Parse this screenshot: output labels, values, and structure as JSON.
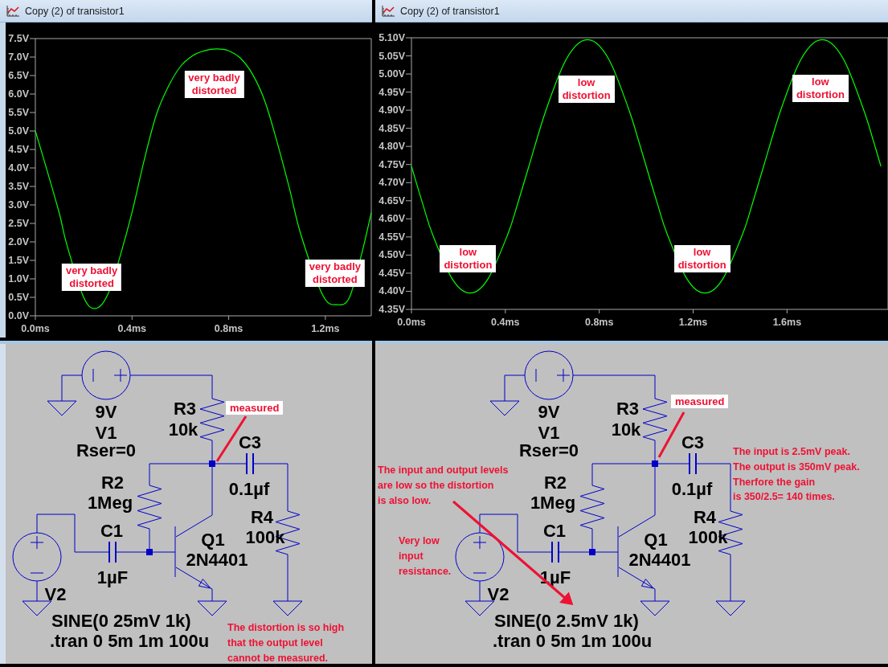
{
  "windows": [
    {
      "title": "Copy (2) of transistor1",
      "chart_data": {
        "type": "line",
        "xlim": [
          0,
          1.39
        ],
        "ylim": [
          0,
          7.5
        ],
        "x": [
          0,
          0.05,
          0.1,
          0.13,
          0.2,
          0.25,
          0.3,
          0.35,
          0.4,
          0.45,
          0.5,
          0.55,
          0.6,
          0.65,
          0.7,
          0.75,
          0.8,
          0.85,
          0.9,
          0.95,
          1.0,
          1.05,
          1.1,
          1.19,
          1.25,
          1.3,
          1.35,
          1.39
        ],
        "series": [
          {
            "color": "#00ff00",
            "values": [
              5.0,
              3.9,
              2.75,
              1.93,
              0.5,
              0.2,
              0.58,
              1.6,
              2.8,
              4.2,
              5.43,
              6.2,
              6.74,
              7.03,
              7.17,
              7.22,
              7.17,
              6.96,
              6.52,
              5.8,
              4.71,
              3.48,
              2.17,
              0.55,
              0.3,
              0.5,
              1.67,
              2.79
            ]
          }
        ],
        "xticks": [
          {
            "value": 0,
            "label": "0.0ms"
          },
          {
            "value": 0.4,
            "label": "0.4ms"
          },
          {
            "value": 0.8,
            "label": "0.8ms"
          },
          {
            "value": 1.2,
            "label": "1.2ms"
          }
        ],
        "yticks": [
          {
            "value": 0,
            "label": "0.0V"
          },
          {
            "value": 0.5,
            "label": "0.5V"
          },
          {
            "value": 1,
            "label": "1.0V"
          },
          {
            "value": 1.5,
            "label": "1.5V"
          },
          {
            "value": 2,
            "label": "2.0V"
          },
          {
            "value": 2.5,
            "label": "2.5V"
          },
          {
            "value": 3,
            "label": "3.0V"
          },
          {
            "value": 3.5,
            "label": "3.5V"
          },
          {
            "value": 4,
            "label": "4.0V"
          },
          {
            "value": 4.5,
            "label": "4.5V"
          },
          {
            "value": 5,
            "label": "5.0V"
          },
          {
            "value": 5.5,
            "label": "5.5V"
          },
          {
            "value": 6,
            "label": "6.0V"
          },
          {
            "value": 6.5,
            "label": "6.5V"
          },
          {
            "value": 7,
            "label": "7.0V"
          },
          {
            "value": 7.5,
            "label": "7.5V"
          }
        ],
        "annotations": [
          {
            "text": "very badly\ndistorted"
          },
          {
            "text": "very badly\ndistorted"
          },
          {
            "text": "very badly\ndistorted"
          }
        ]
      }
    },
    {
      "title": "Copy (2) of transistor1",
      "chart_data": {
        "type": "line",
        "xlim": [
          0,
          2.03
        ],
        "ylim": [
          4.35,
          5.1
        ],
        "x": [
          0,
          0.05,
          0.09,
          0.175,
          0.25,
          0.325,
          0.41,
          0.45,
          0.5,
          0.57,
          0.645,
          0.7,
          0.75,
          0.8,
          0.855,
          0.93,
          0.97,
          1.0,
          1.05,
          1.09,
          1.175,
          1.25,
          1.325,
          1.41,
          1.45,
          1.5,
          1.57,
          1.645,
          1.7,
          1.75,
          1.8,
          1.855,
          1.93,
          1.97,
          2.0
        ],
        "series": [
          {
            "color": "#00ff00",
            "values": [
              4.745,
              4.637,
              4.557,
              4.433,
              4.395,
              4.433,
              4.557,
              4.637,
              4.745,
              4.894,
              5.022,
              5.078,
              5.095,
              5.078,
              5.022,
              4.894,
              4.81,
              4.745,
              4.637,
              4.557,
              4.433,
              4.395,
              4.433,
              4.557,
              4.637,
              4.745,
              4.894,
              5.022,
              5.078,
              5.095,
              5.078,
              5.022,
              4.894,
              4.81,
              4.745
            ]
          }
        ],
        "xticks": [
          {
            "value": 0,
            "label": "0.0ms"
          },
          {
            "value": 0.4,
            "label": "0.4ms"
          },
          {
            "value": 0.8,
            "label": "0.8ms"
          },
          {
            "value": 1.2,
            "label": "1.2ms"
          },
          {
            "value": 1.6,
            "label": "1.6ms"
          }
        ],
        "yticks": [
          {
            "value": 4.35,
            "label": "4.35V"
          },
          {
            "value": 4.4,
            "label": "4.40V"
          },
          {
            "value": 4.45,
            "label": "4.45V"
          },
          {
            "value": 4.5,
            "label": "4.50V"
          },
          {
            "value": 4.55,
            "label": "4.55V"
          },
          {
            "value": 4.6,
            "label": "4.60V"
          },
          {
            "value": 4.65,
            "label": "4.65V"
          },
          {
            "value": 4.7,
            "label": "4.70V"
          },
          {
            "value": 4.75,
            "label": "4.75V"
          },
          {
            "value": 4.8,
            "label": "4.80V"
          },
          {
            "value": 4.85,
            "label": "4.85V"
          },
          {
            "value": 4.9,
            "label": "4.90V"
          },
          {
            "value": 4.95,
            "label": "4.95V"
          },
          {
            "value": 5.0,
            "label": "5.00V"
          },
          {
            "value": 5.05,
            "label": "5.05V"
          },
          {
            "value": 5.1,
            "label": "5.10V"
          }
        ],
        "annotations": [
          {
            "text": "low\ndistortion"
          },
          {
            "text": "low\ndistortion"
          },
          {
            "text": "low\ndistortion"
          },
          {
            "text": "low\ndistortion"
          }
        ]
      }
    }
  ],
  "schematics": [
    {
      "components": [
        {
          "kind": "voltage_source",
          "ref": "V1",
          "value": "9V",
          "param": "Rser=0"
        },
        {
          "kind": "resistor",
          "ref": "R3",
          "value": "10k"
        },
        {
          "kind": "resistor",
          "ref": "R2",
          "value": "1Meg"
        },
        {
          "kind": "capacitor",
          "ref": "C1",
          "value": "1µF"
        },
        {
          "kind": "npn",
          "ref": "Q1",
          "value": "2N4401"
        },
        {
          "kind": "capacitor",
          "ref": "C3",
          "value": "0.1µf"
        },
        {
          "kind": "resistor",
          "ref": "R4",
          "value": "100k"
        },
        {
          "kind": "voltage_source",
          "ref": "V2",
          "value": "SINE(0 25mV 1k)"
        }
      ],
      "directive": ".tran 0 5m 1m 100u",
      "notes": [
        {
          "kind": "tag",
          "lines": [
            "measured"
          ]
        },
        {
          "kind": "note",
          "lines": [
            "The distortion is so high",
            "that the output level",
            "cannot be measured."
          ]
        }
      ]
    },
    {
      "components": [
        {
          "kind": "voltage_source",
          "ref": "V1",
          "value": "9V",
          "param": "Rser=0"
        },
        {
          "kind": "resistor",
          "ref": "R3",
          "value": "10k"
        },
        {
          "kind": "resistor",
          "ref": "R2",
          "value": "1Meg"
        },
        {
          "kind": "capacitor",
          "ref": "C1",
          "value": "1µF"
        },
        {
          "kind": "npn",
          "ref": "Q1",
          "value": "2N4401"
        },
        {
          "kind": "capacitor",
          "ref": "C3",
          "value": "0.1µf"
        },
        {
          "kind": "resistor",
          "ref": "R4",
          "value": "100k"
        },
        {
          "kind": "voltage_source",
          "ref": "V2",
          "value": "SINE(0 2.5mV 1k)"
        }
      ],
      "directive": ".tran 0 5m 1m 100u",
      "notes": [
        {
          "kind": "tag",
          "lines": [
            "measured"
          ]
        },
        {
          "kind": "note",
          "lines": [
            "The input and output levels",
            "are low so the distortion",
            "is also low."
          ]
        },
        {
          "kind": "note",
          "lines": [
            "Very low",
            "input",
            "resistance."
          ]
        },
        {
          "kind": "note",
          "lines": [
            "The input is 2.5mV peak.",
            "The output is 350mV peak.",
            "Therfore the gain",
            "is 350/2.5= 140 times."
          ]
        }
      ]
    }
  ]
}
